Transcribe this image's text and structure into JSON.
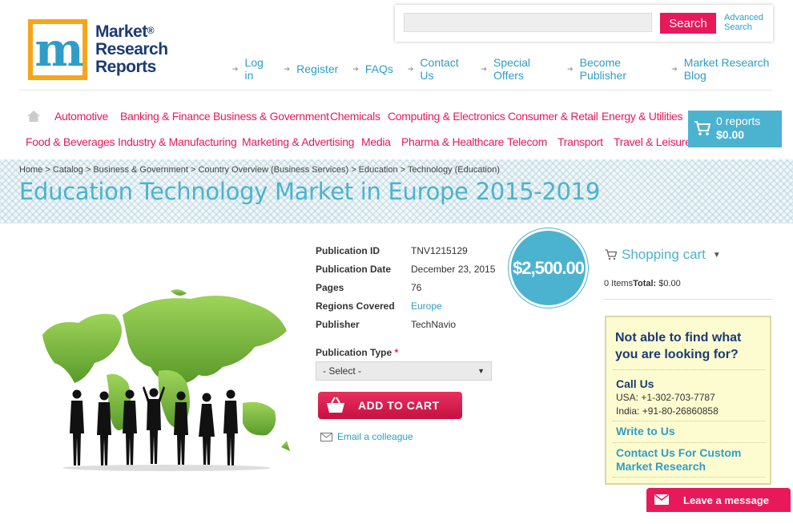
{
  "logo": {
    "line1": "Market",
    "line2": "Research",
    "line3": "Reports",
    "reg": "®"
  },
  "search": {
    "placeholder": "",
    "button_label": "Search",
    "advanced_line1": "Advanced",
    "advanced_line2": "Search"
  },
  "top_links": [
    "Log in",
    "Register",
    "FAQs",
    "Contact Us",
    "Special Offers",
    "Become Publisher",
    "Market Research Blog"
  ],
  "categories_row1": [
    "Automotive",
    "Banking & Finance",
    "Business & Government",
    "Chemicals",
    "Computing & Electronics",
    "Consumer & Retail",
    "Energy & Utilities"
  ],
  "categories_row2": [
    "Food & Beverages",
    "Industry & Manufacturing",
    "Marketing & Advertising",
    "Media",
    "Pharma & Healthcare",
    "Telecom",
    "Transport",
    "Travel & Leisure"
  ],
  "cart_badge": {
    "reports": "0 reports",
    "total": "$0.00"
  },
  "breadcrumb": "Home > Catalog > Business & Government > Country Overview (Business Services) > Education > Technology (Education)",
  "page_title": "Education Technology Market in Europe 2015-2019",
  "details": [
    {
      "label": "Publication ID",
      "value": "TNV1215129"
    },
    {
      "label": "Publication Date",
      "value": "December 23, 2015"
    },
    {
      "label": "Pages",
      "value": "76"
    },
    {
      "label": "Regions Covered",
      "value": "Europe"
    },
    {
      "label": "Publisher",
      "value": "TechNavio"
    }
  ],
  "price": "$2,500.00",
  "publication_type": {
    "label": "Publication Type",
    "required_mark": "*",
    "selected": "- Select -"
  },
  "add_to_cart": "ADD TO CART",
  "email_colleague": "Email a colleague",
  "shopping_cart": {
    "title": "Shopping cart",
    "items": "0 Items",
    "total_label": "Total:",
    "total_value": "$0.00"
  },
  "help": {
    "question": "Not able to find what you are looking for?",
    "call_us": "Call Us",
    "usa": "USA: +1-302-703-7787",
    "india": "India: +91-80-26860858",
    "write_to_us": "Write to Us",
    "custom": "Contact Us For Custom Market Research"
  },
  "leave_message": "Leave a message",
  "colors": {
    "accent_pink": "#e7195a",
    "accent_blue": "#4bb3cf",
    "logo_orange": "#f6a51d",
    "logo_navy": "#1b3b73"
  }
}
